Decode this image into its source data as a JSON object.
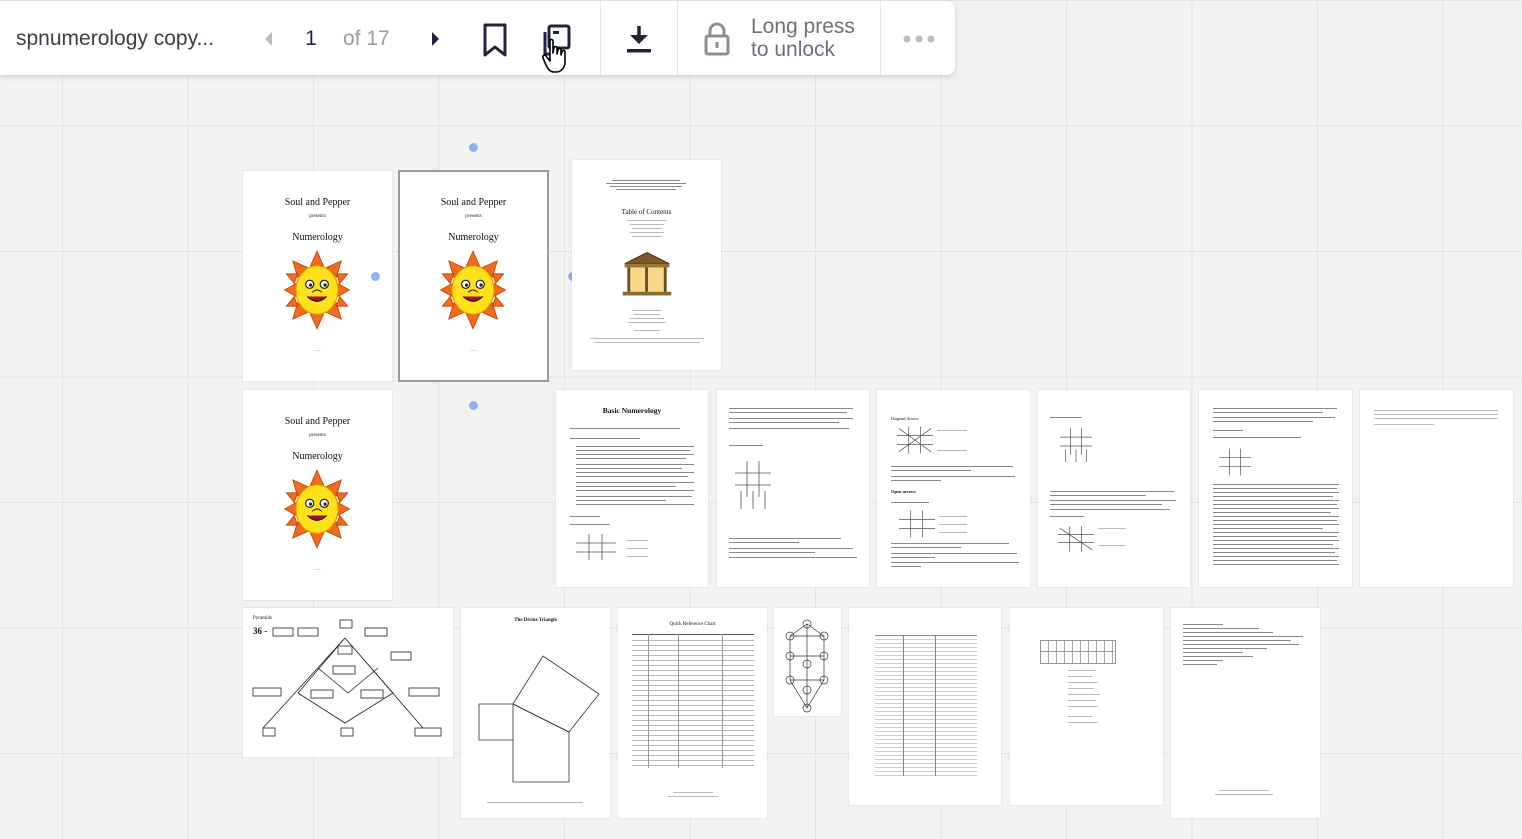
{
  "toolbar": {
    "file_name": "spnumerology copy...",
    "current_page": "1",
    "total_pages_label": "of 17",
    "lock_label": "Long press to unlock",
    "icons": {
      "prev": "chevron-left-icon",
      "next": "chevron-right-icon",
      "bookmark": "bookmark-icon",
      "copy": "copy-pages-icon",
      "download": "download-icon",
      "lock": "lock-icon",
      "more": "more-horizontal-icon"
    }
  },
  "colors": {
    "canvas": "#f2f2f2",
    "grid": "#e3e3e3",
    "toolbar_text": "#1f2340",
    "muted": "#9a9caa",
    "selection_handle": "#8fb0ee",
    "sun_orange": "#f26a1b",
    "sun_yellow": "#ffe11a"
  },
  "pages": {
    "cover": {
      "title": "Soul and Pepper",
      "presents": "presents",
      "subtitle": "Numerology"
    },
    "toc": {
      "title": "Table of Contents"
    },
    "basic": {
      "title": "Basic Numerology"
    },
    "diagonal": {
      "label1": "Diagonal Arrows",
      "label2": "Open arrows"
    },
    "pyramids": {
      "title": "Pyramids",
      "formula": "36 -"
    },
    "triangle": {
      "title": "The Divine Triangle"
    },
    "quick": {
      "title": "Quick Reference Chart"
    }
  }
}
